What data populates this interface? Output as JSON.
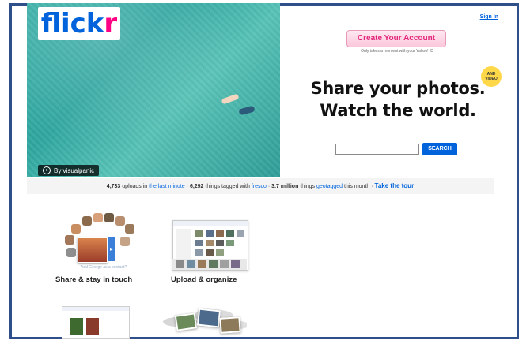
{
  "logo": {
    "part1": "flick",
    "part2": "r"
  },
  "header": {
    "sign_in": "Sign In"
  },
  "hero": {
    "credit": "By visualpanic",
    "cc_icon": "cc-icon"
  },
  "signup": {
    "create_label": "Create Your Account",
    "subtext": "Only takes a moment with your Yahoo! ID"
  },
  "badge": {
    "line1": "AND",
    "line2": "VIDEO"
  },
  "headline": {
    "line1": "Share your photos.",
    "line2": "Watch the world."
  },
  "search": {
    "value": "",
    "button": "SEARCH"
  },
  "stats": {
    "uploads_count": "4,733",
    "uploads_text": "uploads in",
    "uploads_link": "the last minute",
    "tagged_count": "6,292",
    "tagged_text": "things tagged with",
    "tagged_link": "fresco",
    "geo_count": "3.7 million",
    "geo_text": "things",
    "geo_link": "geotagged",
    "geo_suffix": "this month",
    "sep": "·",
    "tour": "Take the tour"
  },
  "features": [
    {
      "label": "Share & stay in touch",
      "hint": "Add George as a contact?"
    },
    {
      "label": "Upload & organize"
    }
  ],
  "colors": {
    "flickr_blue": "#0063dc",
    "flickr_pink": "#ff0084",
    "frame": "#2f4f8a"
  }
}
